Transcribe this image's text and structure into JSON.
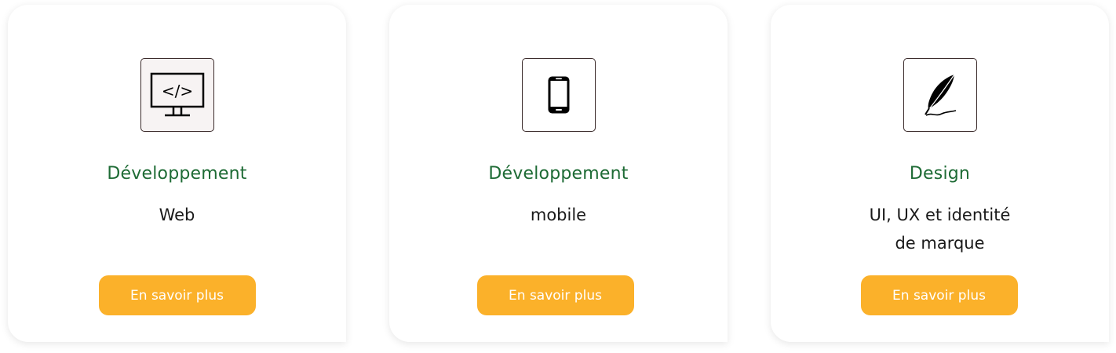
{
  "colors": {
    "title": "#1e6b35",
    "button": "#fbb12a",
    "button_text": "#ffffff",
    "card_bg": "#ffffff"
  },
  "cards": [
    {
      "icon": "monitor-code-icon",
      "title": "Développement",
      "subtitle": "Web",
      "button_label": "En savoir plus"
    },
    {
      "icon": "smartphone-icon",
      "title": "Développement",
      "subtitle": "mobile",
      "button_label": "En savoir plus"
    },
    {
      "icon": "quill-pen-icon",
      "title": "Design",
      "subtitle": "UI, UX et identité\n de marque",
      "button_label": "En savoir plus"
    }
  ]
}
